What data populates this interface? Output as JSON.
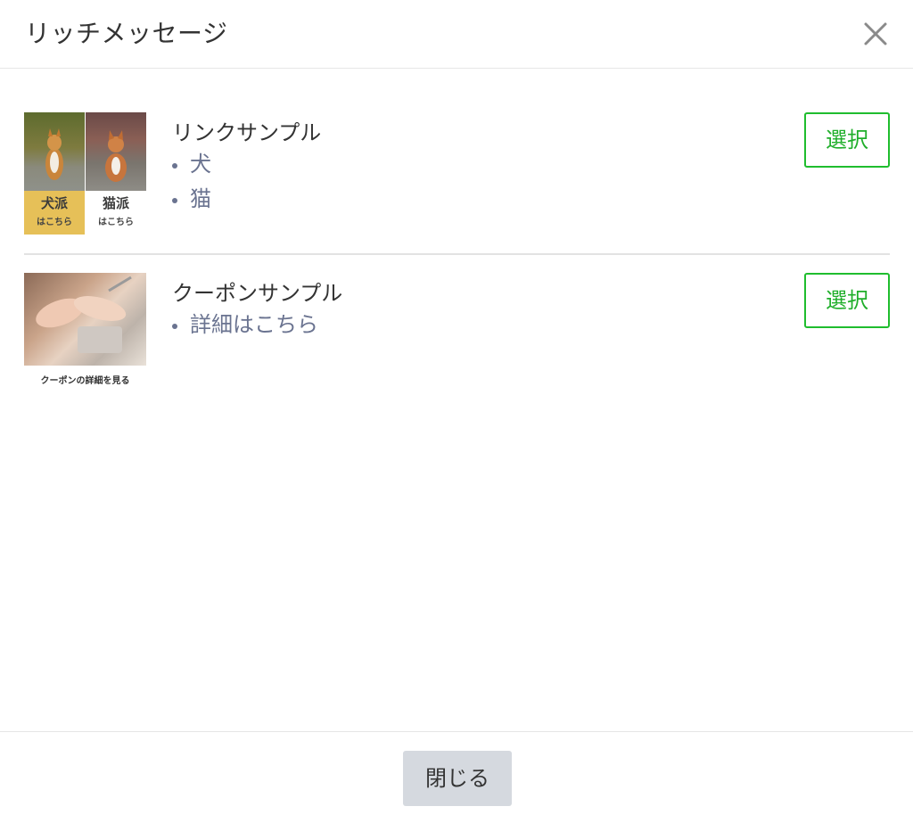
{
  "header": {
    "title": "リッチメッセージ",
    "close_icon": "close-icon"
  },
  "items": [
    {
      "title": "リンクサンプル",
      "links": [
        "犬",
        "猫"
      ],
      "select_label": "選択",
      "thumbnail": {
        "left_big": "犬派",
        "left_small": "はこちら",
        "right_big": "猫派",
        "right_small": "はこちら",
        "left_label_color": "#e6c058"
      }
    },
    {
      "title": "クーポンサンプル",
      "links": [
        "詳細はこちら"
      ],
      "select_label": "選択",
      "thumbnail": {
        "caption": "クーポンの詳細を見る"
      }
    }
  ],
  "footer": {
    "close_label": "閉じる"
  },
  "colors": {
    "accent_green": "#1fbd2e",
    "link_color": "#6a7390",
    "footer_button_bg": "#d5d9df"
  }
}
